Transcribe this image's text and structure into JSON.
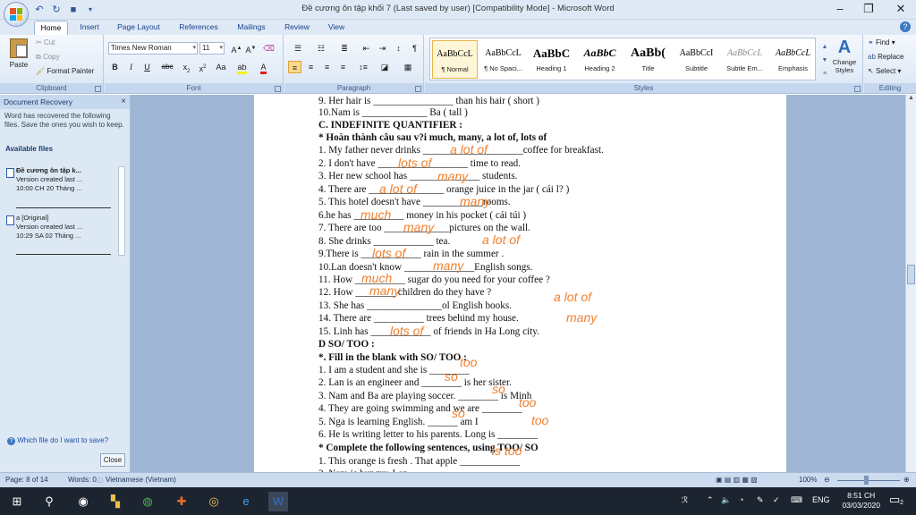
{
  "window": {
    "title": "Đề cương ôn tập khối 7 (Last saved by user) [Compatibility Mode] - Microsoft Word",
    "minimize": "–",
    "restore": "❐",
    "close": "✕"
  },
  "tabs": [
    "Home",
    "Insert",
    "Page Layout",
    "References",
    "Mailings",
    "Review",
    "View"
  ],
  "ribbon": {
    "clipboard": {
      "label": "Clipboard",
      "paste": "Paste",
      "cut": "Cut",
      "copy": "Copy",
      "format_painter": "Format Painter"
    },
    "font": {
      "label": "Font",
      "font_name": "Times New Roman",
      "font_size": "11"
    },
    "paragraph": {
      "label": "Paragraph"
    },
    "styles": {
      "label": "Styles",
      "items": [
        {
          "sample": "AaBbCcL",
          "name": "¶ Normal"
        },
        {
          "sample": "AaBbCcL",
          "name": "¶ No Spaci..."
        },
        {
          "sample": "AaBbC",
          "name": "Heading 1"
        },
        {
          "sample": "AaBbC",
          "name": "Heading 2"
        },
        {
          "sample": "AaBb(",
          "name": "Title"
        },
        {
          "sample": "AaBbCcI",
          "name": "Subtitle"
        },
        {
          "sample": "AaBbCcL",
          "name": "Subtle Em..."
        },
        {
          "sample": "AaBbCcL",
          "name": "Emphasis"
        }
      ],
      "change_styles": "Change Styles"
    },
    "editing": {
      "label": "Editing",
      "find": "Find",
      "replace": "Replace",
      "select": "Select"
    }
  },
  "recovery": {
    "header": "Document Recovery",
    "message": "Word has recovered the following files. Save the ones you wish to keep.",
    "available": "Available files",
    "files": [
      {
        "name": "Đề cương ôn tập k...",
        "line2": "Version created last ...",
        "line3": "10:00 CH 20 Tháng ..."
      },
      {
        "name": "a [Original]",
        "line2": "Version created last ...",
        "line3": "10:29 SA 02 Tháng ..."
      }
    ],
    "which_link": "Which file do I want to save?",
    "close_button": "Close"
  },
  "document": {
    "lines": [
      {
        "text": "9. Her hair is ________________ than his hair ( short )"
      },
      {
        "text": "10.Nam is _____________ Ba ( tall )"
      },
      {
        "text": "C. INDEFINITE QUANTIFIER :",
        "bold": true
      },
      {
        "text": "* Hoàn thành câu sau v?i much, many, a lot of, lots of",
        "bold": true
      },
      {
        "text": "1. My father never drinks ____________________coffee  for breakfast."
      },
      {
        "text": "2. I don't have __________________ time to read."
      },
      {
        "text": "3. Her new school  has ______________ students."
      },
      {
        "text": "4. There are _______________ orange juice in the jar ( cái l? )"
      },
      {
        "text": "5. This hotel  doesn't have ____________rooms."
      },
      {
        "text": "6.he has __________ money in his pocket ( cái túi )"
      },
      {
        "text": "7. There are too _____________pictures on the wall."
      },
      {
        "text": "8. She drinks ____________ tea."
      },
      {
        "text": "9.There is ____________ rain in the summer ."
      },
      {
        "text": "10.Lan doesn't know ______________English songs."
      },
      {
        "text": "11. How __________ sugar  do you need  for your coffee ?"
      },
      {
        "text": "12. How ________ children do they have ?"
      },
      {
        "text": "13. She has _______________ol English books."
      },
      {
        "text": "14. There are __________ trees  behind my house."
      },
      {
        "text": "15. Linh  has ____________ of friends in Ha Long city."
      },
      {
        "text": "D SO/ TOO :",
        "bold": true
      },
      {
        "text": "*. Fill in the blank with SO/ TOO :",
        "bold": true
      },
      {
        "text": "1. I am a  student and  she is ________"
      },
      {
        "text": "2. Lan is an engineer and ________ is her sister."
      },
      {
        "text": "3. Nam and Ba are playing soccer. ________ is Minh"
      },
      {
        "text": "4. They are going swimming and we are ________"
      },
      {
        "text": "5. Nga is learning English. ______ am I"
      },
      {
        "text": "6. He is writing letter to his parents. Long is ________"
      },
      {
        "text": "* Complete the following sentences, using TOO/ SO",
        "bold": true
      },
      {
        "text": "1. This orange is fresh . That apple ____________"
      },
      {
        "text": "2. Nam is hungry.                  Lan"
      }
    ],
    "answers": [
      "a lot of",
      "lots of",
      "many",
      "a lot of",
      "many",
      "much",
      "many",
      "a lot of",
      "lots of",
      "many",
      "much",
      "many",
      "a lot of",
      "many",
      "lots of",
      "too",
      "so",
      "so",
      "too",
      "so",
      "too",
      "is too"
    ]
  },
  "status": {
    "page": "Page: 8 of 14",
    "words": "Words: 0",
    "language": "Vietnamese (Vietnam)",
    "zoom": "100%"
  },
  "taskbar": {
    "language": "ENG",
    "time": "8:51 CH",
    "date": "03/03/2020",
    "notifications": "2"
  }
}
